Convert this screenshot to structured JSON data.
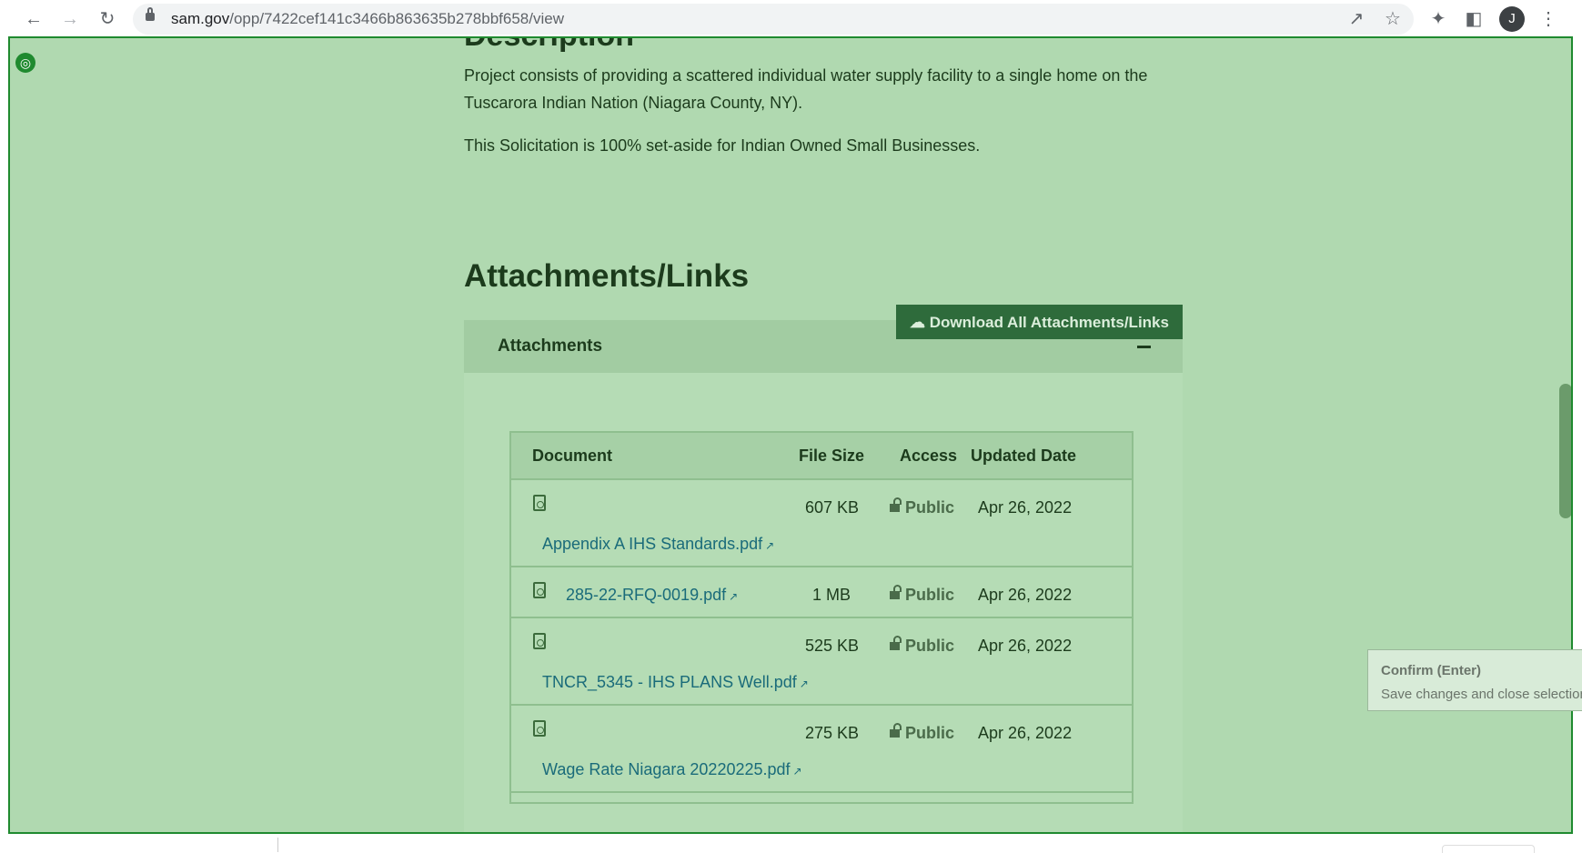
{
  "browser": {
    "url_host": "sam.gov",
    "url_path": "/opp/7422cef141c3466b863635b278bbf658/view",
    "profile_initial": "J"
  },
  "description": {
    "title": "Description",
    "paragraph1_line1": "Project consists of providing a scattered individual water supply facility to a single home on the",
    "paragraph1_line2": "Tuscarora Indian Nation (Niagara County, NY).",
    "paragraph2": "This Solicitation is 100% set-aside for Indian Owned Small Businesses."
  },
  "attachments": {
    "section_title": "Attachments/Links",
    "download_button": "Download All Attachments/Links",
    "panel_label": "Attachments",
    "headers": {
      "document": "Document",
      "file_size": "File Size",
      "access": "Access",
      "updated_date": "Updated Date"
    },
    "rows": [
      {
        "name": "Appendix A IHS Standards.pdf",
        "size": "607 KB",
        "access": "Public",
        "date": "Apr 26, 2022"
      },
      {
        "name": "285-22-RFQ-0019.pdf",
        "size": "1 MB",
        "access": "Public",
        "date": "Apr 26, 2022"
      },
      {
        "name": "TNCR_5345 - IHS PLANS Well.pdf",
        "size": "525 KB",
        "access": "Public",
        "date": "Apr 26, 2022"
      },
      {
        "name": "Wage Rate Niagara 20220225.pdf",
        "size": "275 KB",
        "access": "Public",
        "date": "Apr 26, 2022"
      }
    ]
  },
  "tooltip": {
    "title": "Confirm (Enter)",
    "text": "Save changes and close selection"
  },
  "colors": {
    "overlay": "#b0d9b0",
    "overlay_border": "#1f8a2f",
    "link": "#1a6b7a",
    "button": "#2e6b3b"
  }
}
